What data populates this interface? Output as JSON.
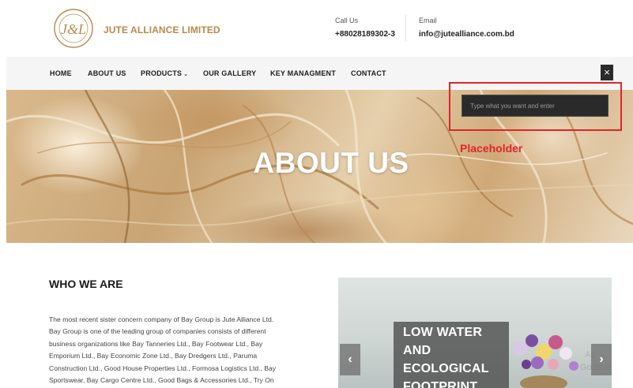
{
  "header": {
    "logo_text": "J&L",
    "brand": "JUTE ALLIANCE LIMITED",
    "call_label": "Call Us",
    "call_value": "+88028189302-3",
    "email_label": "Email",
    "email_value": "info@jutealliance.com.bd"
  },
  "nav": {
    "items": [
      "HOME",
      "ABOUT US",
      "PRODUCTS",
      "OUR GALLERY",
      "KEY MANAGMENT",
      "CONTACT"
    ],
    "close_icon": "close-icon"
  },
  "hero": {
    "title": "ABOUT US"
  },
  "search": {
    "placeholder": "Type what you want and enter"
  },
  "annotation": {
    "label": "Placeholder",
    "color": "#e0242a"
  },
  "about": {
    "title": "WHO WE ARE",
    "lines": [
      "The most recent sister concern company of Bay Group is Jute Alliance Ltd.",
      "Bay Group is one of the leading group of companies consists of different",
      "business organizations like Bay Tanneries Ltd., Bay Footwear Ltd., Bay",
      "Emporium Ltd., Bay Economic Zone Ltd., Bay Dredgers Ltd., Paruma",
      "Construction Ltd., Good House Properties Ltd., Formosa Logistics Ltd., Bay",
      "Sportswear, Bay Cargo Centre Ltd., Good Bags & Accessories Ltd., Try On"
    ]
  },
  "slider": {
    "lines": [
      "LOW WATER",
      "AND",
      "ECOLOGICAL",
      "FOOTPRINT"
    ],
    "prev_icon": "chevron-left-icon",
    "next_icon": "chevron-right-icon",
    "ghost_lines": [
      "Ac",
      "Go to S"
    ]
  },
  "colors": {
    "brand": "#b8894a",
    "nav_bg": "#f5f5f5",
    "search_bg": "#2a2a2a"
  }
}
